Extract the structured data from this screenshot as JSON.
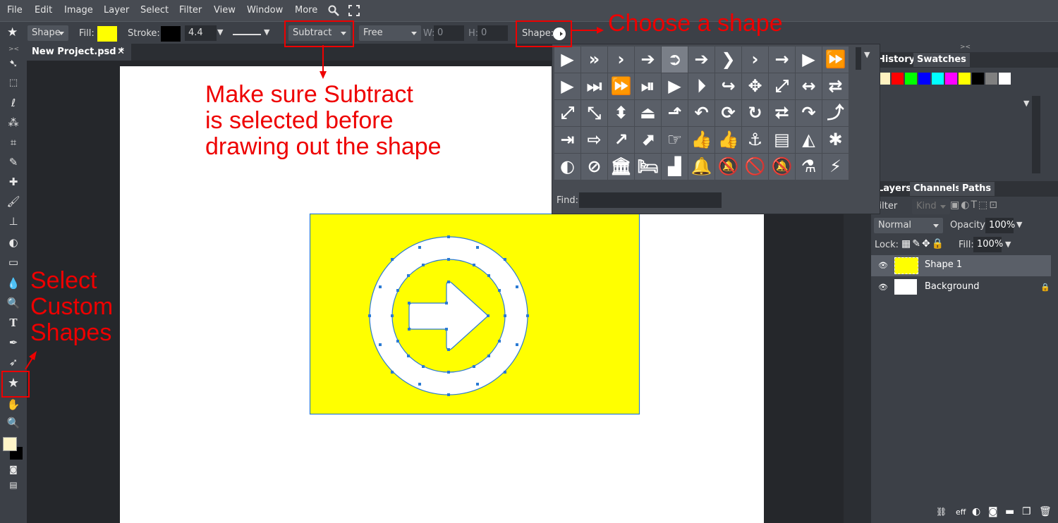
{
  "menu": [
    "File",
    "Edit",
    "Image",
    "Layer",
    "Select",
    "Filter",
    "View",
    "Window",
    "More"
  ],
  "options": {
    "tool_mode": "Shape",
    "fill_label": "Fill:",
    "stroke_label": "Stroke:",
    "stroke_width": "4.4 px",
    "operation": "Subtract",
    "size_mode": "Free",
    "w_label": "W:",
    "w_value": "0",
    "h_label": "H:",
    "h_value": "0",
    "shape_label": "Shape:",
    "fill_color": "#ffff00",
    "stroke_color": "#000000"
  },
  "tab": {
    "title": "New Project.psd *",
    "close": "✕"
  },
  "popup": {
    "find_label": "Find:",
    "shapes": [
      [
        "▶",
        "»",
        "›",
        "➔",
        "➲",
        "➔",
        "❯",
        "›",
        "→",
        "▶",
        "⏩"
      ],
      [
        "▶",
        "⏭",
        "⏩",
        "⏯",
        "▶",
        "⏵",
        "↪",
        "✥",
        "⤢",
        "↔",
        "⇄"
      ],
      [
        "⤢",
        "⤡",
        "⬍",
        "⏏",
        "⬏",
        "↶",
        "⟳",
        "↻",
        "⮂",
        "↷",
        "⤴"
      ],
      [
        "⇥",
        "⇨",
        "↗",
        "⬈",
        "☞",
        "👍",
        "👍",
        "⚓",
        "▤",
        "◭",
        "✱"
      ],
      [
        "◐",
        "⊘",
        "🏛",
        "🛏",
        "▟",
        "🔔",
        "🔕",
        "🚫",
        "🔕",
        "⚗",
        "⚡"
      ]
    ]
  },
  "panels": {
    "history_tab": "History",
    "swatches_tab": "Swatches",
    "swatches": [
      "#fff2c0",
      "#ff0000",
      "#00ff00",
      "#0000ff",
      "#00ffff",
      "#ff00ff",
      "#ffff00",
      "#000000",
      "#808080",
      "#ffffff"
    ],
    "layers_tab": "Layers",
    "channels_tab": "Channels",
    "paths_tab": "Paths",
    "filter_label": "Filter",
    "kind_label": "Kind",
    "blend_mode": "Normal",
    "opacity_label": "Opacity:",
    "opacity_value": "100%",
    "lock_label": "Lock:",
    "fill_label": "Fill:",
    "fill_value": "100%",
    "layers": [
      {
        "name": "Shape 1",
        "selected": true
      },
      {
        "name": "Background",
        "selected": false
      }
    ],
    "bottom_icons": [
      "link-icon",
      "eff",
      "half-circle-icon",
      "mask-icon",
      "folder-icon",
      "new-layer-icon",
      "trash-icon"
    ],
    "eff_label": "eff"
  },
  "annotations": {
    "choose_shape": "Choose a shape",
    "subtract_line1": "Make sure Subtract",
    "subtract_line2": "is selected before",
    "subtract_line3": "drawing out the shape",
    "select_line1": "Select",
    "select_line2": "Custom",
    "select_line3": "Shapes"
  },
  "colors": {
    "accent_red": "#e00000",
    "path_blue": "#2b7bd4",
    "shape_yellow": "#ffff00",
    "foreground": "#fff5c8",
    "background": "#000000"
  }
}
